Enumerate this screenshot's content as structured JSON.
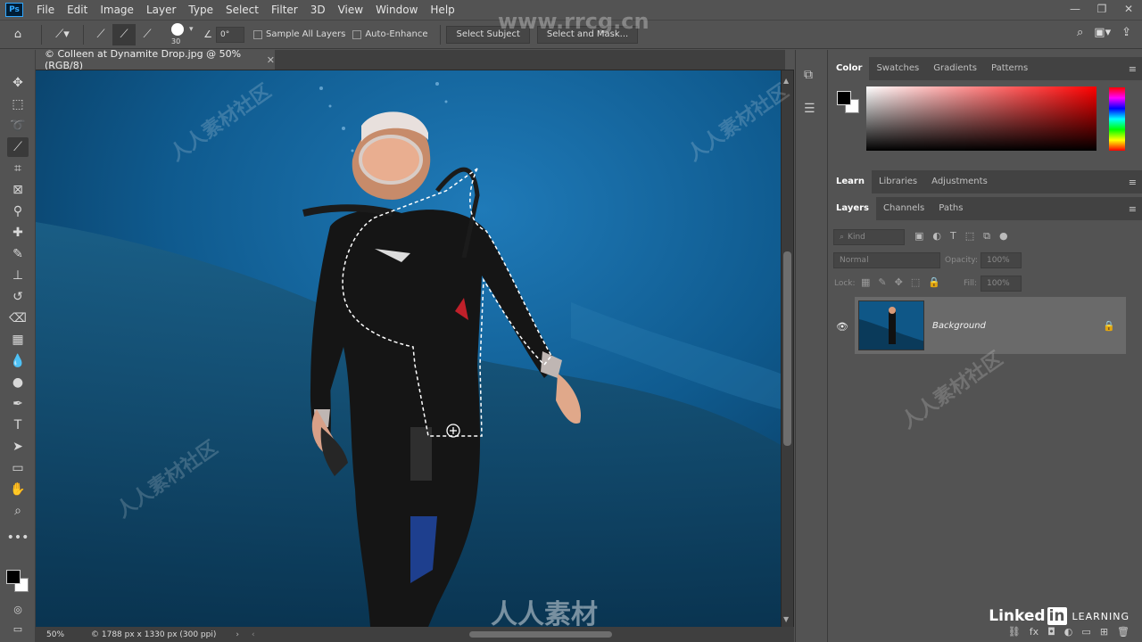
{
  "menubar": {
    "logo": "Ps",
    "items": [
      "File",
      "Edit",
      "Image",
      "Layer",
      "Type",
      "Select",
      "Filter",
      "3D",
      "View",
      "Window",
      "Help"
    ]
  },
  "options": {
    "brush_size": "30",
    "angle": "0°",
    "sample_all_layers": "Sample All Layers",
    "auto_enhance": "Auto-Enhance",
    "select_subject": "Select Subject",
    "select_and_mask": "Select and Mask..."
  },
  "document": {
    "tab_title": "© Colleen at Dynamite Drop.jpg @ 50% (RGB/8)",
    "zoom": "50%",
    "info": "© 1788 px x 1330 px (300 ppi)"
  },
  "panels": {
    "color_tabs": [
      "Color",
      "Swatches",
      "Gradients",
      "Patterns"
    ],
    "learn_tabs": [
      "Learn",
      "Libraries",
      "Adjustments"
    ],
    "layers_tabs": [
      "Layers",
      "Channels",
      "Paths"
    ],
    "kind_placeholder": "Kind",
    "blend_mode": "Normal",
    "opacity_label": "Opacity:",
    "opacity_value": "100%",
    "lock_label": "Lock:",
    "fill_label": "Fill:",
    "fill_value": "100%"
  },
  "layers": [
    {
      "name": "Background"
    }
  ],
  "watermark": {
    "site": "www.rrcg.cn",
    "brand": "人人素材",
    "repeat": "人人素材社区"
  },
  "linkedin": {
    "logo_word": "Linked",
    "logo_in": "in",
    "learning": "LEARNING"
  }
}
